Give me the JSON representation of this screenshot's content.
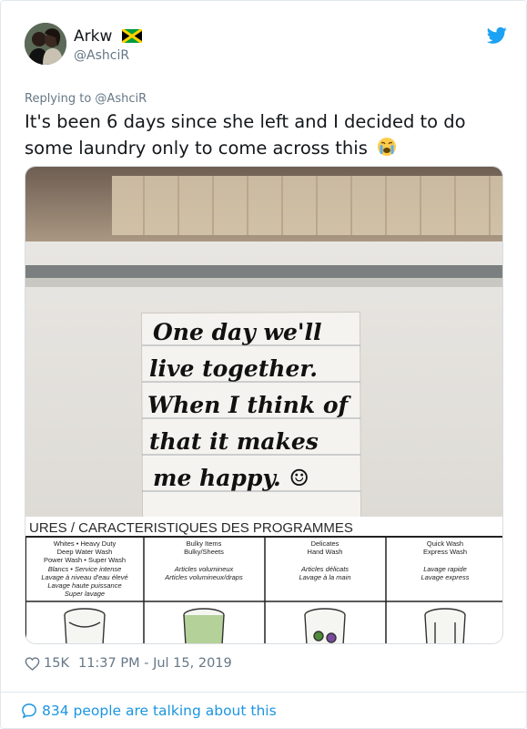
{
  "tweet": {
    "display_name": "Arkw",
    "handle": "@AshciR",
    "flag_icon": "jamaica-flag-icon",
    "replying_to": "Replying to @AshciR",
    "text": "It's been 6 days since she left and I decided to do some laundry only to come across this",
    "emoji_icon": "loudly-crying-face-icon"
  },
  "photo": {
    "note_lines": [
      "One day we'll",
      "live together.",
      "When I think of",
      "that it makes",
      "me happy. ☺"
    ],
    "panel_title": "URES / CARACTERISTIQUES DES PROGRAMMES",
    "columns": [
      {
        "lines": [
          "Whites • Heavy Duty",
          "Deep Water Wash",
          "Power Wash • Super Wash"
        ],
        "italic": [
          "Blancs • Service intense",
          "Lavage à niveau d'eau élevé",
          "Lavage haute puissance",
          "Super lavage"
        ]
      },
      {
        "lines": [
          "Bulky Items",
          "Bulky/Sheets"
        ],
        "italic": [
          "Articles volumineux",
          "Articles volumineux/draps"
        ]
      },
      {
        "lines": [
          "Delicates",
          "Hand Wash"
        ],
        "italic": [
          "Articles délicats",
          "Lavage à la main"
        ]
      },
      {
        "lines": [
          "Quick Wash",
          "Express Wash"
        ],
        "italic": [
          "Lavage rapide",
          "Lavage express"
        ]
      }
    ]
  },
  "footer": {
    "likes": "15K",
    "timestamp": "11:37 PM - Jul 15, 2019",
    "talking": "834 people are talking about this"
  },
  "colors": {
    "link": "#1b95e0",
    "muted": "#657786",
    "text": "#14171a",
    "twitter_blue": "#1da1f2"
  }
}
